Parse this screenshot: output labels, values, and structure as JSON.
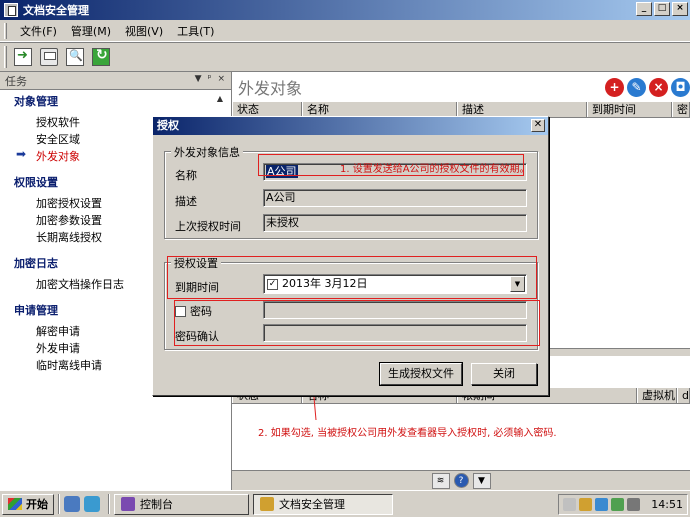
{
  "window": {
    "title": "文档安全管理"
  },
  "menu": [
    {
      "label": "文件(F)"
    },
    {
      "label": "管理(M)"
    },
    {
      "label": "视图(V)"
    },
    {
      "label": "工具(T)"
    }
  ],
  "toolbar": [
    "export-icon",
    "print-icon",
    "preview-icon",
    "refresh-icon"
  ],
  "taskpane": {
    "header": "任务",
    "groups": [
      {
        "title": "对象管理",
        "items": [
          "授权软件",
          "安全区域",
          "外发对象"
        ],
        "active": 2
      },
      {
        "title": "权限设置",
        "items": [
          "加密授权设置",
          "加密参数设置",
          "长期离线授权"
        ]
      },
      {
        "title": "加密日志",
        "items": [
          "加密文档操作日志"
        ]
      },
      {
        "title": "申请管理",
        "items": [
          "解密申请",
          "外发申请",
          "临时离线申请"
        ]
      }
    ]
  },
  "main": {
    "heading": "外发对象",
    "columns": [
      "状态",
      "名称",
      "描述",
      "到期时间",
      "密"
    ],
    "bottom_columns": [
      "状态",
      "名称",
      "帐期间",
      "虚拟机",
      "d"
    ]
  },
  "dialog": {
    "title": "授权",
    "close": "✕",
    "group1_legend": "外发对象信息",
    "name_label": "名称",
    "name_value": "A公司",
    "desc_label": "描述",
    "desc_value": "A公司",
    "last_auth_label": "上次授权时间",
    "last_auth_value": "未授权",
    "group2_legend": "授权设置",
    "expiry_label": "到期时间",
    "expiry_value": "2013年  3月12日",
    "password_label": "密码",
    "confirm_label": "密码确认",
    "generate_button": "生成授权文件",
    "close_button": "关闭"
  },
  "annotations": {
    "note1": "1. 设置发送给A公司的授权文件的有效期。",
    "note2": "2. 如果勾选, 当被授权公司用外发查看器导入授权时, 必须输入密码."
  },
  "taskbar": {
    "start": "开始",
    "tasks": [
      {
        "label": "控制台"
      },
      {
        "label": "文档安全管理"
      }
    ],
    "clock": "14:51"
  },
  "colors": {
    "accent": "#0a246a",
    "annotation": "#d01010"
  }
}
